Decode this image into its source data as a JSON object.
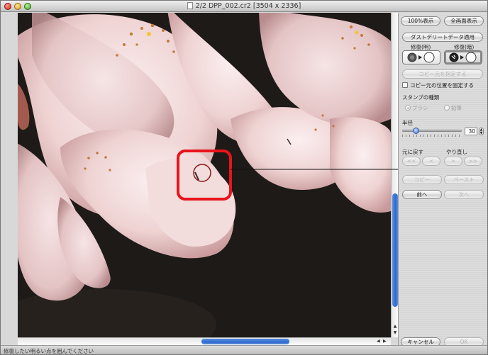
{
  "window": {
    "title": "2/2 DPP_002.cr2 [3504 x 2336]"
  },
  "panel": {
    "zoom_100_label": "100%表示",
    "fit_screen_label": "全画面表示",
    "apply_dust_label": "ダストデリートデータ適用",
    "repair_dark_label": "修復(明)",
    "repair_light_label": "修復(暗)",
    "set_copy_source_label": "コピー元を指定する",
    "fix_copy_source_label": "コピー元の位置を固定する",
    "stamp_type_label": "スタンプの種類",
    "brush_label": "ブラシ",
    "pencil_label": "鉛筆",
    "radius_label": "半径",
    "radius_value": "30",
    "undo_label": "元に戻す",
    "redo_label": "やり直し",
    "undo_all_label": "<<",
    "undo_one_label": "<",
    "redo_one_label": ">",
    "redo_all_label": ">>",
    "copy_label": "コピー",
    "paste_label": "ペースト",
    "prev_label": "前へ",
    "next_label": "次へ",
    "cancel_label": "キャンセル",
    "ok_label": "OK"
  },
  "status": {
    "text": "修復したい明るい点を囲んでください"
  },
  "colors": {
    "highlight": "#e8141b",
    "cursor_circle": "#8b1a1a",
    "scroll_accent": "#2e6ad0"
  },
  "icons": {
    "window_close": "close-icon",
    "window_minimize": "minimize-icon",
    "window_zoom": "zoom-icon",
    "repair_dark_icon": "dark-spot-to-circle-icon",
    "repair_light_icon": "light-spot-to-circle-icon"
  }
}
